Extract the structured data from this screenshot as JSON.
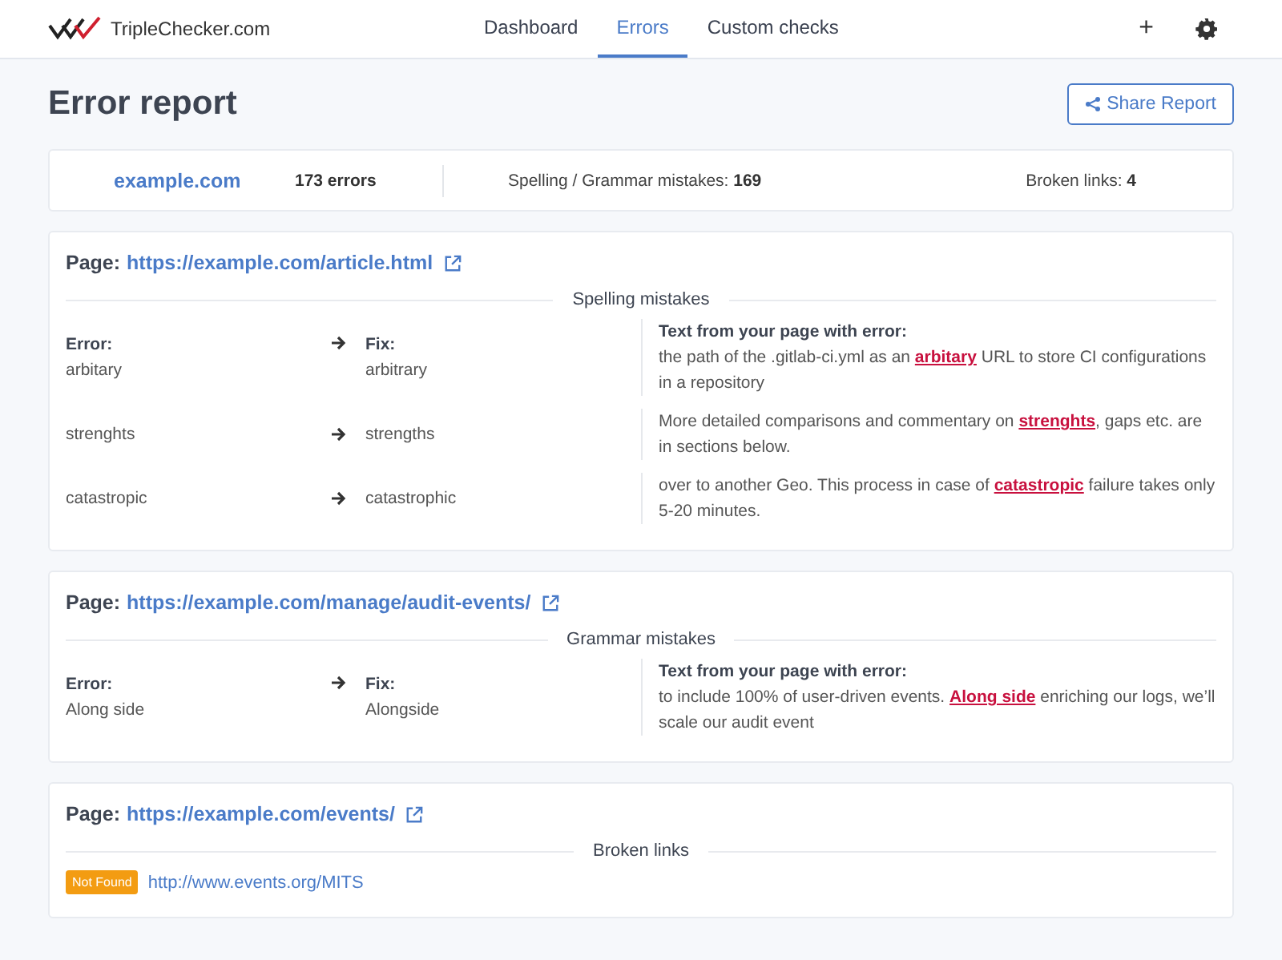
{
  "brand": {
    "name": "TripleChecker.com"
  },
  "nav": {
    "tabs": [
      {
        "label": "Dashboard",
        "selected": false
      },
      {
        "label": "Errors",
        "selected": true
      },
      {
        "label": "Custom checks",
        "selected": false
      }
    ],
    "add": "+"
  },
  "title": "Error report",
  "share_button": "Share Report",
  "summary": {
    "site": "example.com",
    "errors": "173 errors",
    "spelling_label": "Spelling / Grammar mistakes:",
    "spelling_count": "169",
    "links_label": "Broken links:",
    "links_count": "4"
  },
  "sections": [
    {
      "kind": "mistakes",
      "page_label": "Page:",
      "url": "https://example.com/article.html",
      "heading": "Spelling mistakes",
      "error_label": "Error:",
      "fix_label": "Fix:",
      "context_label": "Text from your page with error:",
      "rows": [
        {
          "error": "arbitary",
          "fix": "arbitrary",
          "before": "the path of the .gitlab-ci.yml as an ",
          "word": "arbitary",
          "after": " URL to store CI configurations in a repository"
        },
        {
          "error": "strenghts",
          "fix": "strengths",
          "before": "More detailed comparisons and commentary on ",
          "word": "strenghts",
          "after": ", gaps etc. are in sections below."
        },
        {
          "error": "catastropic",
          "fix": "catastrophic",
          "before": "over to another Geo. This process in case of ",
          "word": "catastropic",
          "after": " failure takes only 5-20 minutes."
        }
      ]
    },
    {
      "kind": "mistakes",
      "page_label": "Page:",
      "url": "https://example.com/manage/audit-events/",
      "heading": "Grammar mistakes",
      "error_label": "Error:",
      "fix_label": "Fix:",
      "context_label": "Text from your page with error:",
      "rows": [
        {
          "error": "Along side",
          "fix": "Alongside",
          "before": "to include 100% of user-driven events. ",
          "word": "Along side",
          "after": " enriching our logs, we’ll scale our audit event"
        }
      ]
    },
    {
      "kind": "links",
      "page_label": "Page:",
      "url": "https://example.com/events/",
      "heading": "Broken links",
      "links": [
        {
          "status": "Not Found",
          "url": "http://www.events.org/MITS"
        }
      ]
    }
  ]
}
